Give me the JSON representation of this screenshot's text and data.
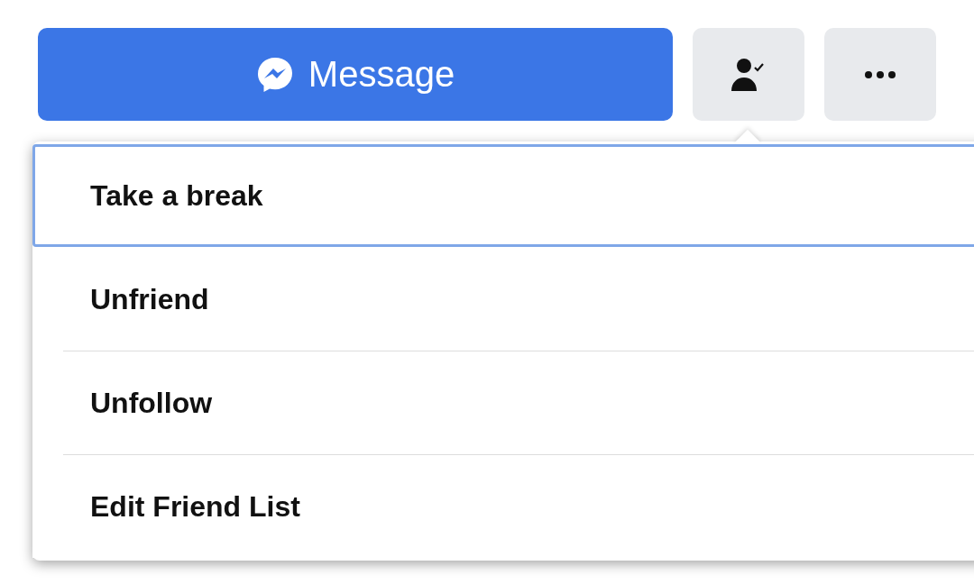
{
  "actions": {
    "message_button": {
      "label": "Message"
    },
    "friends_button": {
      "expanded": true
    }
  },
  "friend_menu": {
    "items": [
      {
        "label": "Take a break",
        "selected": true
      },
      {
        "label": "Unfriend",
        "selected": false
      },
      {
        "label": "Unfollow",
        "selected": false
      },
      {
        "label": "Edit Friend List",
        "selected": false
      }
    ]
  }
}
